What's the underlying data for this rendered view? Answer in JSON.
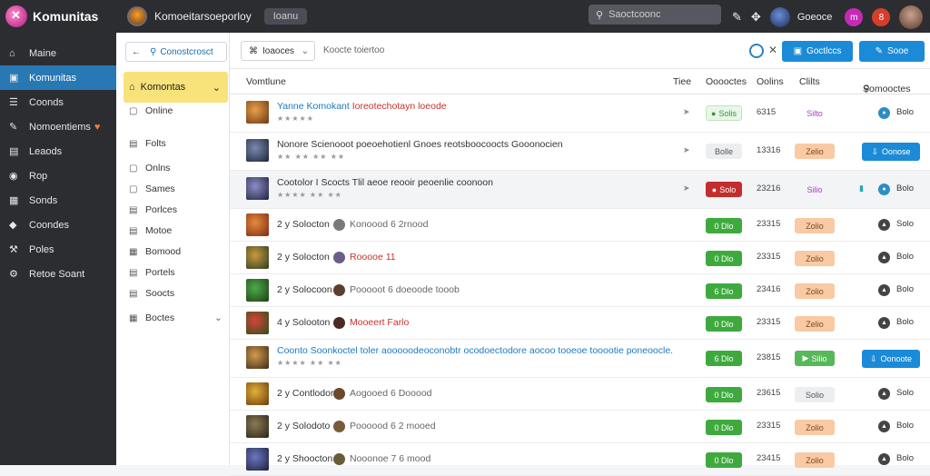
{
  "topbar": {
    "brand": "Komunitas",
    "title": "Komoeitarsoeporloy",
    "pill": "Ioanu",
    "search_placeholder": "Saoctcoonc",
    "user": "Goeoce",
    "badge1": "m",
    "badge2": "8"
  },
  "sidebar": {
    "items": [
      {
        "label": "Maine",
        "icon": "home-icon"
      },
      {
        "label": "Komunitas",
        "icon": "community-icon",
        "active": true
      },
      {
        "label": "Coonds",
        "icon": "list-icon"
      },
      {
        "label": "Nomoentiems",
        "icon": "pen-icon",
        "heart": true
      },
      {
        "label": "Leaods",
        "icon": "box-icon"
      },
      {
        "label": "Rop",
        "icon": "circle-icon"
      },
      {
        "label": "Sonds",
        "icon": "server-icon"
      },
      {
        "label": "Coondes",
        "icon": "tag-icon"
      },
      {
        "label": "Poles",
        "icon": "wrench-icon"
      },
      {
        "label": "Retoe Soant",
        "icon": "gear-icon"
      }
    ]
  },
  "subsidebar": {
    "button": "Conostcrosct",
    "selected": "Komontas",
    "items": [
      {
        "label": "Online",
        "icon": "page-icon"
      },
      {
        "label": "Folts",
        "icon": "doc-icon"
      },
      {
        "label": "Onlns",
        "icon": "square-icon"
      },
      {
        "label": "Sames",
        "icon": "square-icon"
      },
      {
        "label": "Porlces",
        "icon": "doc-icon"
      },
      {
        "label": "Motoe",
        "icon": "doc-icon"
      },
      {
        "label": "Bomood",
        "icon": "box-icon"
      },
      {
        "label": "Portels",
        "icon": "doc-icon"
      },
      {
        "label": "Soocts",
        "icon": "doc-icon"
      },
      {
        "label": "Boctes",
        "icon": "box-icon",
        "chevron": true
      }
    ]
  },
  "toolbar": {
    "filter": "Ioaoces",
    "hint": "Koocte toiertoo",
    "btn1": "Goctlccs",
    "btn2": "Sooe"
  },
  "table_header": {
    "name": "Vomtlune",
    "time": "Tiee",
    "status": "Ooooctes",
    "count": "Oolins",
    "tag": "Clilts",
    "last": "Somooctes"
  },
  "rows": [
    {
      "title": "Komokant",
      "title_prefix": "Yanne",
      "title_rest": "Ioreotechotayn loeode",
      "stars": "★★★★★",
      "status": "Solis",
      "count": "6315",
      "tag": "Silto",
      "dot": "Bolo"
    },
    {
      "title": "Nonore Scienooot poeoehotienl Gnoes reotsboocoocts Gooonocien",
      "stars": "★★ ★★ ★★ ★★",
      "status": "Bolle",
      "count": "13316",
      "tag": "Zelio",
      "btn": "Oonose",
      "dot": ""
    },
    {
      "title": "Cootolor I Scocts Tlil aeoe reooir peoenlie coonoon",
      "stars": "★★★★ ★★ ★★",
      "status": "Solo",
      "count": "23216",
      "tag": "Silio",
      "dot": "Bolo"
    },
    {
      "num": "2 y Solocton",
      "meta": "Konoood 6 2rnood",
      "status": "0 Dlo",
      "count": "23315",
      "tag": "Zolio",
      "dot": "Solo"
    },
    {
      "num": "2 y Solocton",
      "meta": "Rooooe 11",
      "status": "0 Dlo",
      "count": "23315",
      "tag": "Zolio",
      "dot": "Bolo"
    },
    {
      "num": "2 y Solocoon",
      "meta": "Pooooot 6 doeoode tooob",
      "status": "6 Dlo",
      "count": "23416",
      "tag": "Zolio",
      "dot": "Bolo"
    },
    {
      "num": "4 y Solooton",
      "meta": "Mooeert Farlo",
      "status": "0 Dlo",
      "count": "23315",
      "tag": "Zelio",
      "dot": "Bolo"
    },
    {
      "title": "Coonto Soonkoctel toler aooooodeoconobtr ocodoectodore aocoo tooeoe tooootie poneoocle.",
      "stars": "★★★★ ★★ ★★",
      "status": "6 Dlo",
      "count": "23815",
      "tag": "Silio",
      "btn": "Oonoote",
      "dot": ""
    },
    {
      "num": "2 y Contlodon",
      "meta": "Aogooed 6 Dooood",
      "status": "0 Dlo",
      "count": "23615",
      "tag": "Solio",
      "dot": "Solo"
    },
    {
      "num": "2 y Solodoto",
      "meta": "Poooood 6 2 mooed",
      "status": "0 Dlo",
      "count": "23315",
      "tag": "Zolio",
      "dot": "Bolo"
    },
    {
      "num": "2 y Shoocton",
      "meta": "Nooonoe 7 6 mood",
      "status": "0 Dlo",
      "count": "23415",
      "tag": "Zolio",
      "dot": "Bolo"
    }
  ]
}
